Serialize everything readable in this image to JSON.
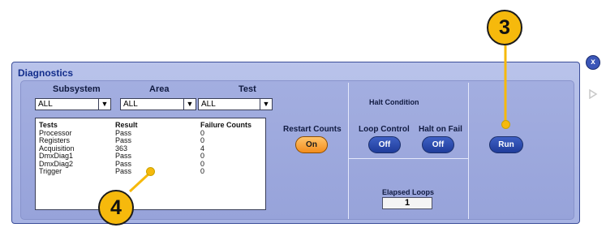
{
  "window": {
    "title": "Diagnostics"
  },
  "filters": {
    "subsystem": {
      "label": "Subsystem",
      "value": "ALL"
    },
    "area": {
      "label": "Area",
      "value": "ALL"
    },
    "test": {
      "label": "Test",
      "value": "ALL"
    }
  },
  "results_table": {
    "headers": [
      "Tests",
      "Result",
      "Failure Counts"
    ],
    "rows": [
      [
        "Processor",
        "Pass",
        "0"
      ],
      [
        "Registers",
        "Pass",
        "0"
      ],
      [
        "Acquisition",
        "363",
        "4"
      ],
      [
        "DmxDiag1",
        "Pass",
        "0"
      ],
      [
        "DmxDiag2",
        "Pass",
        "0"
      ],
      [
        "Trigger",
        "Pass",
        "0"
      ]
    ]
  },
  "restart_counts": {
    "label": "Restart Counts",
    "button": "On"
  },
  "halt_condition": {
    "title": "Halt Condition",
    "loop_control": {
      "label": "Loop Control",
      "button": "Off"
    },
    "halt_on_fail": {
      "label": "Halt on Fail",
      "button": "Off"
    }
  },
  "elapsed_loops": {
    "label": "Elapsed Loops",
    "value": "1"
  },
  "run_button": "Run",
  "callouts": {
    "one": "3",
    "two": "4"
  },
  "side": {
    "close_glyph": "x",
    "icons": [
      "close-icon",
      "arrow-left-icon",
      "arrow-right-icon"
    ]
  },
  "colors": {
    "accent_orange": "#f6b90c",
    "button_blue": "#2a49ad",
    "panel": "#a9b4e4"
  }
}
